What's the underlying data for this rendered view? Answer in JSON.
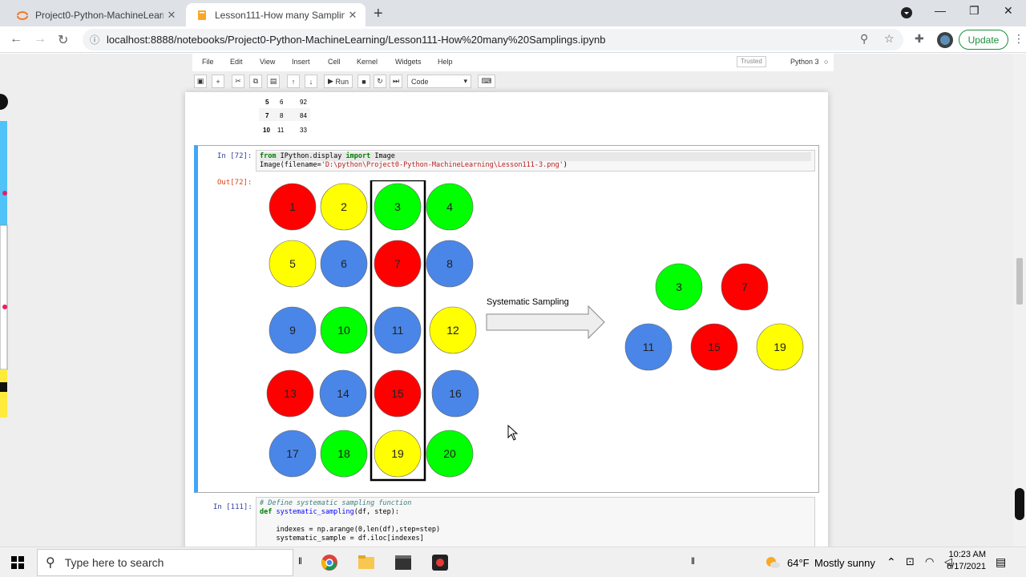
{
  "browser": {
    "tabs": [
      {
        "title": "Project0-Python-MachineLearnin"
      },
      {
        "title": "Lesson111-How many Sampling"
      }
    ],
    "url": "localhost:8888/notebooks/Project0-Python-MachineLearning/Lesson111-How%20many%20Samplings.ipynb",
    "update_label": "Update"
  },
  "jupyter": {
    "menu": [
      "File",
      "Edit",
      "View",
      "Insert",
      "Cell",
      "Kernel",
      "Widgets",
      "Help"
    ],
    "trusted": "Trusted",
    "kernel": "Python 3",
    "run_label": "Run",
    "cell_type": "Code"
  },
  "df_rows": [
    {
      "idx": "5",
      "a": "6",
      "b": "92"
    },
    {
      "idx": "7",
      "a": "8",
      "b": "84"
    },
    {
      "idx": "10",
      "a": "11",
      "b": "33"
    }
  ],
  "cell72": {
    "in_prompt": "In [72]:",
    "out_prompt": "Out[72]:",
    "line1_kw1": "from",
    "line1_mod": " IPython.display ",
    "line1_kw2": "import",
    "line1_name": " Image",
    "line2_pre": "Image(filename=",
    "line2_str": "'D:\\python\\Project0-Python-MachineLearning\\Lesson111-3.png'",
    "line2_post": ")"
  },
  "figure": {
    "arrow_label": "Systematic Sampling",
    "grid": [
      [
        "1",
        "2",
        "3",
        "4"
      ],
      [
        "5",
        "6",
        "7",
        "8"
      ],
      [
        "9",
        "10",
        "11",
        "12"
      ],
      [
        "13",
        "14",
        "15",
        "16"
      ],
      [
        "17",
        "18",
        "19",
        "20"
      ]
    ],
    "sample": [
      "3",
      "7",
      "11",
      "15",
      "19"
    ],
    "colors": {
      "red": "#ff0000",
      "yellow": "#ffff00",
      "green": "#00ff00",
      "blue": "#4a86e8"
    }
  },
  "cell111": {
    "in_prompt": "In [111]:",
    "comment": "# Define systematic sampling function",
    "def_kw": "def",
    "def_name": " systematic_sampling",
    "def_rest": "(df, step):",
    "line3": "    indexes = np.arange(0,len(df),step=step)",
    "line4": "    systematic_sample = df.iloc[indexes]"
  },
  "taskbar": {
    "search_placeholder": "Type here to search",
    "weather_temp": "64°F",
    "weather_desc": "Mostly sunny",
    "time": "10:23 AM",
    "date": "6/17/2021"
  }
}
